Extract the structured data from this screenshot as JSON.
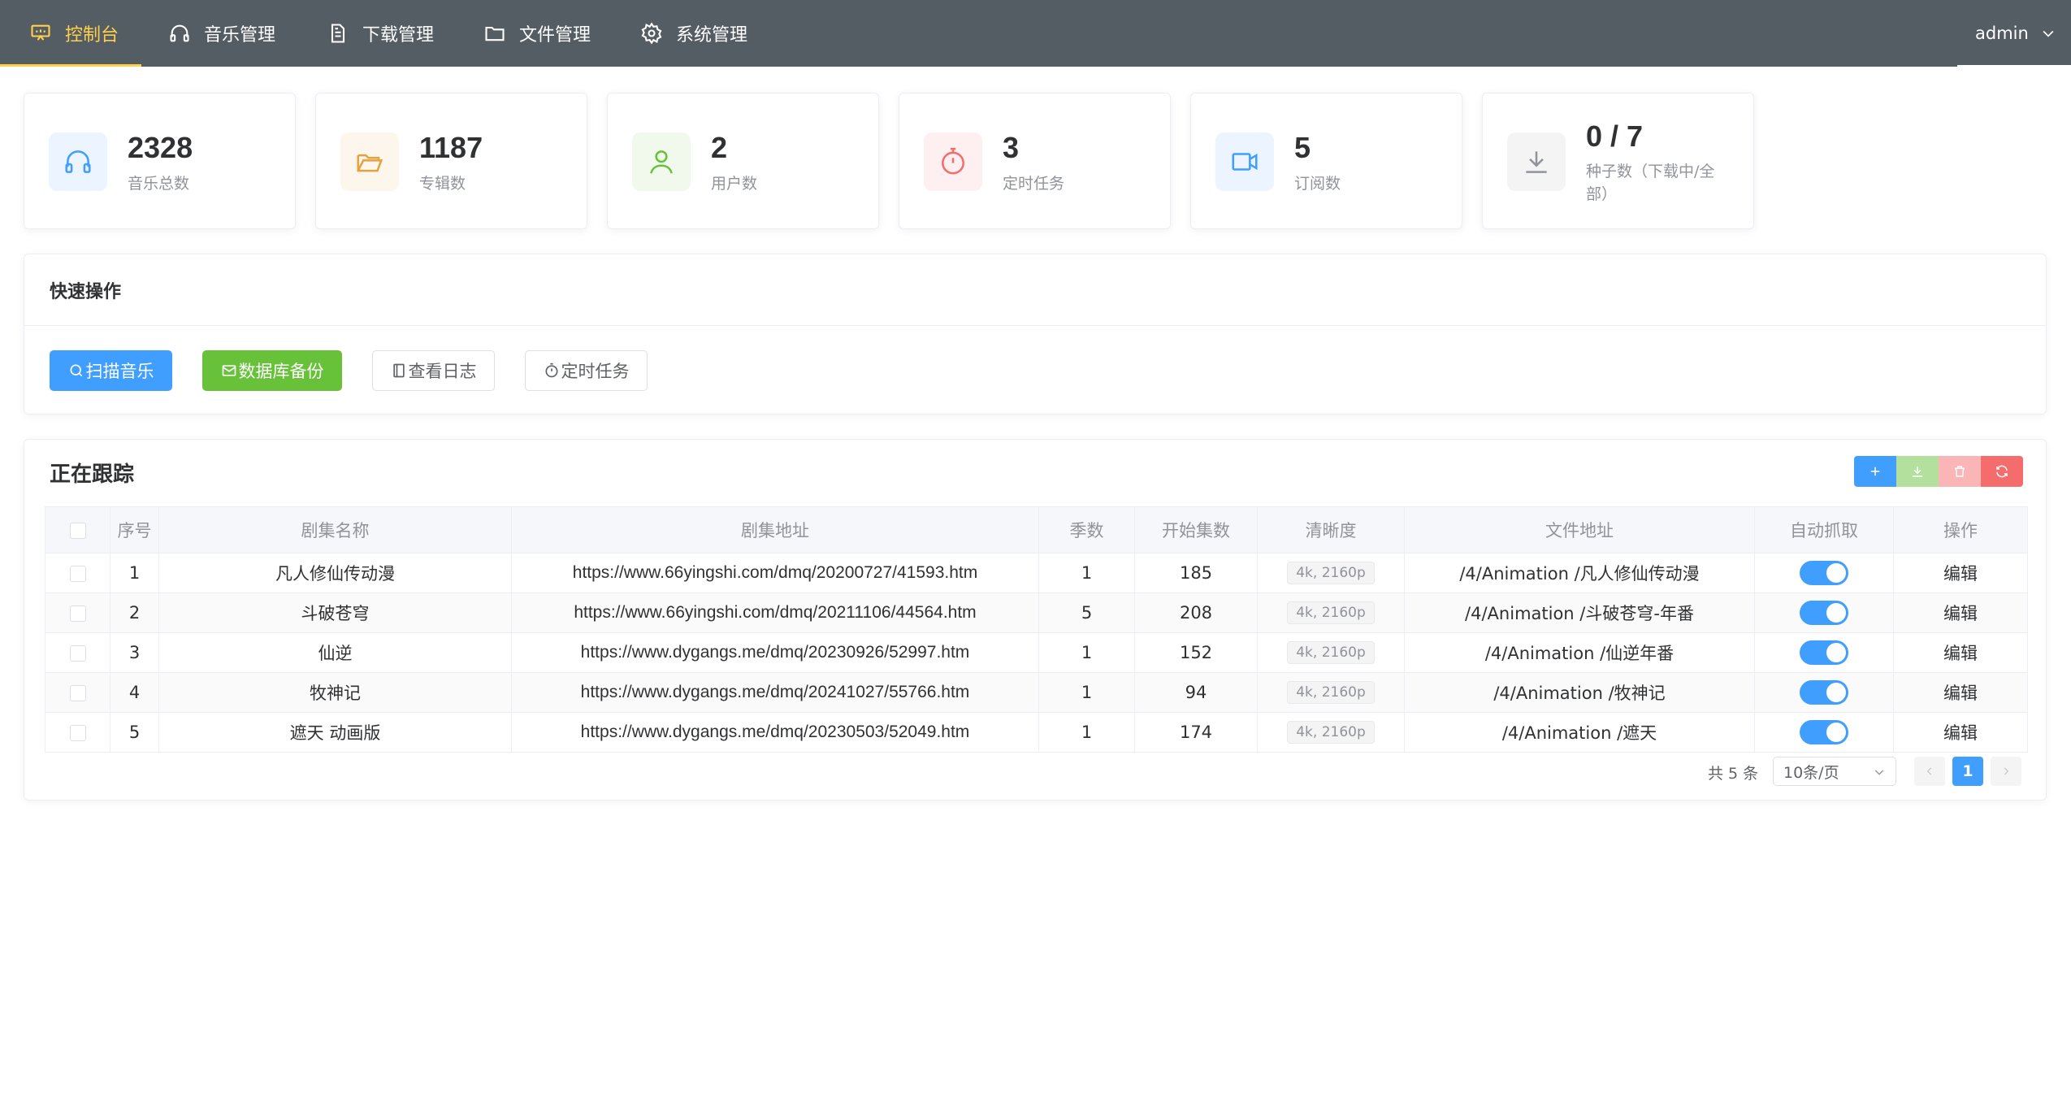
{
  "nav": {
    "items": [
      {
        "label": "控制台",
        "icon": "presentation-icon"
      },
      {
        "label": "音乐管理",
        "icon": "headphones-icon"
      },
      {
        "label": "下载管理",
        "icon": "document-icon"
      },
      {
        "label": "文件管理",
        "icon": "folder-icon"
      },
      {
        "label": "系统管理",
        "icon": "gear-icon"
      }
    ],
    "user": "admin"
  },
  "stats": [
    {
      "value": "2328",
      "label": "音乐总数",
      "icon": "headphones-icon",
      "color": "#409eff"
    },
    {
      "value": "1187",
      "label": "专辑数",
      "icon": "folder-open-icon",
      "color": "#e6a23c"
    },
    {
      "value": "2",
      "label": "用户数",
      "icon": "user-icon",
      "color": "#67c23a"
    },
    {
      "value": "3",
      "label": "定时任务",
      "icon": "stopwatch-icon",
      "color": "#f56c6c"
    },
    {
      "value": "5",
      "label": "订阅数",
      "icon": "video-camera-icon",
      "color": "#409eff"
    },
    {
      "value": "0 / 7",
      "label": "种子数（下载中/全部）",
      "icon": "download-icon",
      "color": "#909399"
    }
  ],
  "quick_actions": {
    "title": "快速操作",
    "buttons": [
      "扫描音乐",
      "数据库备份",
      "查看日志",
      "定时任务"
    ]
  },
  "tracking": {
    "title": "正在跟踪",
    "toolbar": {
      "add": "plus-icon",
      "download": "download-icon",
      "delete": "trash-icon",
      "refresh": "refresh-icon"
    },
    "columns": [
      "序号",
      "剧集名称",
      "剧集地址",
      "季数",
      "开始集数",
      "清晰度",
      "文件地址",
      "自动抓取",
      "操作"
    ],
    "rows": [
      {
        "index": "1",
        "name": "凡人修仙传动漫",
        "url": "https://www.66yingshi.com/dmq/20200727/41593.htm",
        "season": "1",
        "start": "185",
        "quality": "4k, 2160p",
        "path": "/4/Animation /凡人修仙传动漫",
        "auto": true,
        "action": "编辑"
      },
      {
        "index": "2",
        "name": "斗破苍穹",
        "url": "https://www.66yingshi.com/dmq/20211106/44564.htm",
        "season": "5",
        "start": "208",
        "quality": "4k, 2160p",
        "path": "/4/Animation /斗破苍穹-年番",
        "auto": true,
        "action": "编辑"
      },
      {
        "index": "3",
        "name": "仙逆",
        "url": "https://www.dygangs.me/dmq/20230926/52997.htm",
        "season": "1",
        "start": "152",
        "quality": "4k, 2160p",
        "path": "/4/Animation /仙逆年番",
        "auto": true,
        "action": "编辑"
      },
      {
        "index": "4",
        "name": "牧神记",
        "url": "https://www.dygangs.me/dmq/20241027/55766.htm",
        "season": "1",
        "start": "94",
        "quality": "4k, 2160p",
        "path": "/4/Animation /牧神记",
        "auto": true,
        "action": "编辑"
      },
      {
        "index": "5",
        "name": "遮天 动画版",
        "url": "https://www.dygangs.me/dmq/20230503/52049.htm",
        "season": "1",
        "start": "174",
        "quality": "4k, 2160p",
        "path": "/4/Animation /遮天",
        "auto": true,
        "action": "编辑"
      }
    ],
    "pagination": {
      "total": "共 5 条",
      "page_size": "10条/页",
      "current": "1"
    }
  },
  "colors": {
    "nav_bg": "#545c64",
    "nav_active": "#ffd04b",
    "primary": "#409eff",
    "success": "#67c23a",
    "danger": "#f56c6c"
  }
}
